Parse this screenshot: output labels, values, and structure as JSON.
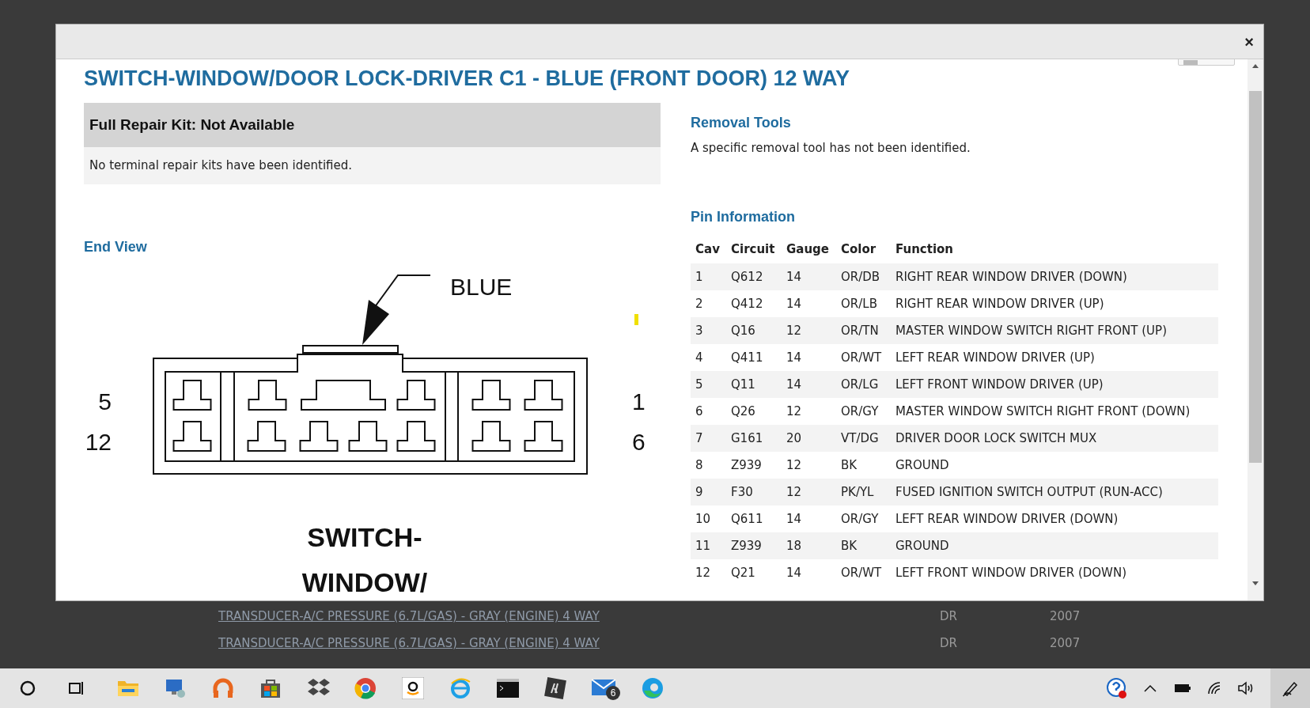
{
  "dialog": {
    "close": "×",
    "title": "SWITCH-WINDOW/DOOR LOCK-DRIVER C1 - BLUE (FRONT DOOR) 12 WAY",
    "repair_kit": {
      "heading": "Full Repair Kit: Not Available",
      "text": "No terminal repair kits have been identified."
    },
    "end_view": {
      "heading": "End View",
      "callout": "BLUE",
      "left_labels": [
        "5",
        "12"
      ],
      "right_labels": [
        "1",
        "6"
      ],
      "caption": [
        "SWITCH-",
        "WINDOW/"
      ]
    },
    "removal_tools": {
      "heading": "Removal Tools",
      "text": "A specific removal tool has not been identified."
    },
    "pin_information": {
      "heading": "Pin Information",
      "columns": [
        "Cav",
        "Circuit",
        "Gauge",
        "Color",
        "Function"
      ],
      "rows": [
        [
          "1",
          "Q612",
          "14",
          "OR/DB",
          "RIGHT REAR WINDOW DRIVER (DOWN)"
        ],
        [
          "2",
          "Q412",
          "14",
          "OR/LB",
          "RIGHT REAR WINDOW DRIVER (UP)"
        ],
        [
          "3",
          "Q16",
          "12",
          "OR/TN",
          "MASTER WINDOW SWITCH RIGHT FRONT (UP)"
        ],
        [
          "4",
          "Q411",
          "14",
          "OR/WT",
          "LEFT REAR WINDOW DRIVER (UP)"
        ],
        [
          "5",
          "Q11",
          "14",
          "OR/LG",
          "LEFT FRONT WINDOW DRIVER (UP)"
        ],
        [
          "6",
          "Q26",
          "12",
          "OR/GY",
          "MASTER WINDOW SWITCH RIGHT FRONT (DOWN)"
        ],
        [
          "7",
          "G161",
          "20",
          "VT/DG",
          "DRIVER DOOR LOCK SWITCH MUX"
        ],
        [
          "8",
          "Z939",
          "12",
          "BK",
          "GROUND"
        ],
        [
          "9",
          "F30",
          "12",
          "PK/YL",
          "FUSED IGNITION SWITCH OUTPUT (RUN-ACC)"
        ],
        [
          "10",
          "Q611",
          "14",
          "OR/GY",
          "LEFT REAR WINDOW DRIVER (DOWN)"
        ],
        [
          "11",
          "Z939",
          "18",
          "BK",
          "GROUND"
        ],
        [
          "12",
          "Q21",
          "14",
          "OR/WT",
          "LEFT FRONT WINDOW DRIVER (DOWN)"
        ]
      ]
    }
  },
  "background_list": [
    {
      "connector": "TRANSDUCER-A/C PRESSURE (6.7L/GAS) - GRAY (ENGINE) 4 WAY",
      "code": "DR",
      "year": "2007"
    },
    {
      "connector": "TRANSDUCER-A/C PRESSURE (6.7L/GAS) - GRAY (ENGINE) 4 WAY",
      "code": "DR",
      "year": "2007"
    }
  ],
  "taskbar": {
    "mail_badge": "6"
  }
}
